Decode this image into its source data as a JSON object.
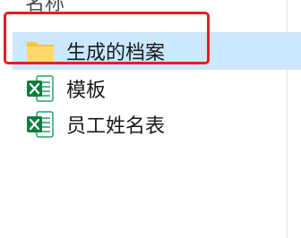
{
  "column_header": "名称",
  "files": [
    {
      "name": "生成的档案",
      "type": "folder",
      "icon": "folder-icon",
      "selected": true
    },
    {
      "name": "模板",
      "type": "excel",
      "icon": "excel-file-icon",
      "selected": false
    },
    {
      "name": "员工姓名表",
      "type": "excel",
      "icon": "excel-file-icon",
      "selected": false
    }
  ],
  "colors": {
    "selection_background": "#cce8ff",
    "highlight_border": "#e51f1f",
    "folder": "#ffd35c",
    "excel_green": "#21a366"
  }
}
